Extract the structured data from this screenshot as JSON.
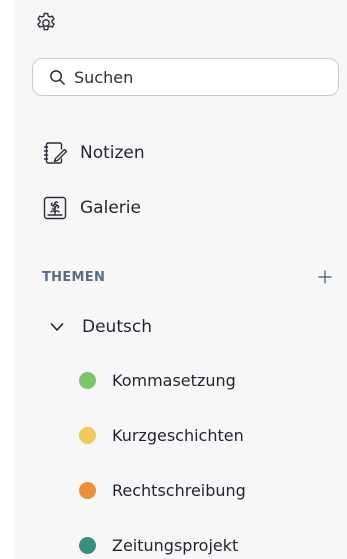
{
  "search": {
    "placeholder": "Suchen"
  },
  "nav": {
    "items": [
      {
        "label": "Notizen",
        "icon": "notebook-pencil-icon"
      },
      {
        "label": "Galerie",
        "icon": "gallery-flower-icon"
      }
    ]
  },
  "topics_section": {
    "title": "THEMEN",
    "add_icon": "plus-icon"
  },
  "group": {
    "label": "Deutsch",
    "icon": "chevron-down-icon",
    "items": [
      {
        "label": "Kommasetzung",
        "color": "#7ac56a"
      },
      {
        "label": "Kurzgeschichten",
        "color": "#f0c95c"
      },
      {
        "label": "Rechtschreibung",
        "color": "#ea8f3a"
      },
      {
        "label": "Zeitungsprojekt",
        "color": "#3c8c80"
      }
    ]
  },
  "colors": {
    "sidebar_bg": "#f7f7f8",
    "text": "#1f2430",
    "section_header": "#5a6c84"
  },
  "icons": {
    "settings": "gear-icon",
    "search": "search-icon"
  }
}
